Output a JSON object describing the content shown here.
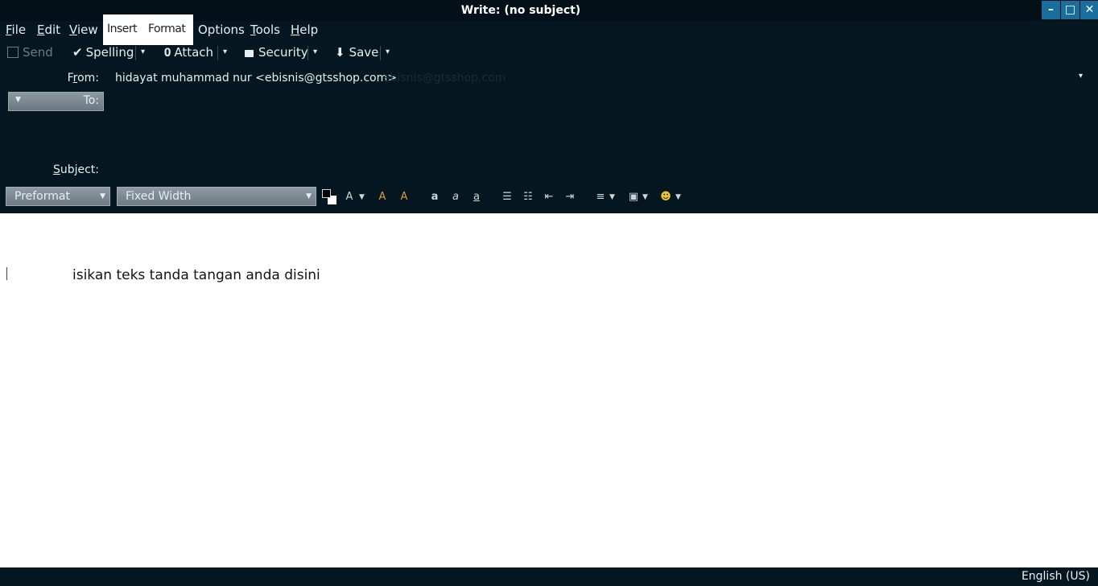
{
  "window": {
    "title": "Write: (no subject)",
    "controls": {
      "minimize": "–",
      "maximize": "□",
      "close": "✕"
    }
  },
  "menu": {
    "file": "File",
    "edit": "Edit",
    "view": "View",
    "insert": "Insert",
    "format": "Format",
    "options": "Options",
    "tools": "Tools",
    "help": "Help"
  },
  "toolbar": {
    "send": "Send",
    "spelling": "Spelling",
    "attach": "Attach",
    "security": "Security",
    "save": "Save",
    "dropdown_glyph": "▾"
  },
  "header": {
    "from_label_prefix": "F",
    "from_label_ul": "r",
    "from_label_suffix": "om:",
    "from_value": "hidayat muhammad nur <ebisnis@gtsshop.com>",
    "from_ghost": "ebisnis@gtsshop.com",
    "to_label": "To:",
    "subject_label_ul": "S",
    "subject_label_suffix": "ubject:"
  },
  "format_bar": {
    "paragraph_style": "Preformat",
    "font": "Fixed Width"
  },
  "body": {
    "signature": "isikan teks tanda tangan anda disini"
  },
  "status": {
    "language": "English (US)"
  },
  "colors": {
    "chrome": "#041620",
    "accent": "#1a6e9e"
  }
}
